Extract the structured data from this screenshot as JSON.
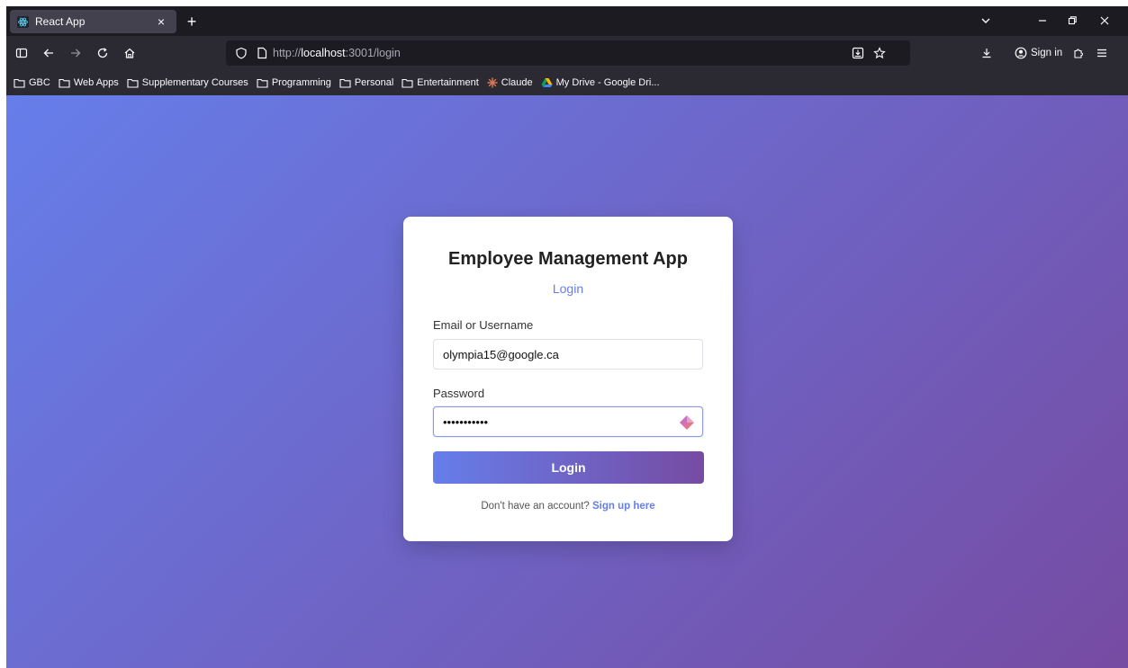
{
  "browser": {
    "tab": {
      "title": "React App",
      "favicon": "react-atom-icon",
      "close": "×"
    },
    "new_tab": "+",
    "window_controls": {
      "list_tabs": "⌄",
      "minimize": "–",
      "restore": "⧉",
      "close": "×"
    },
    "url": {
      "scheme": "http://",
      "host": "localhost",
      "rest": ":3001/login"
    },
    "sign_in": "Sign in",
    "bookmarks": [
      {
        "label": "GBC",
        "icon": "folder-icon"
      },
      {
        "label": "Web Apps",
        "icon": "folder-icon"
      },
      {
        "label": "Supplementary Courses",
        "icon": "folder-icon"
      },
      {
        "label": "Programming",
        "icon": "folder-icon"
      },
      {
        "label": "Personal",
        "icon": "folder-icon"
      },
      {
        "label": "Entertainment",
        "icon": "folder-icon"
      },
      {
        "label": "Claude",
        "icon": "claude-icon"
      },
      {
        "label": "My Drive - Google Dri...",
        "icon": "google-drive-icon"
      }
    ]
  },
  "page": {
    "app_title": "Employee Management App",
    "subtitle": "Login",
    "email_label": "Email or Username",
    "email_value": "olympia15@google.ca",
    "password_label": "Password",
    "password_value": "•••••••••••",
    "login_button": "Login",
    "footer_text": "Don't have an account?",
    "footer_link": "Sign up here"
  },
  "colors": {
    "gradient_start": "#667eea",
    "gradient_end": "#764ba2",
    "accent": "#667eea"
  }
}
